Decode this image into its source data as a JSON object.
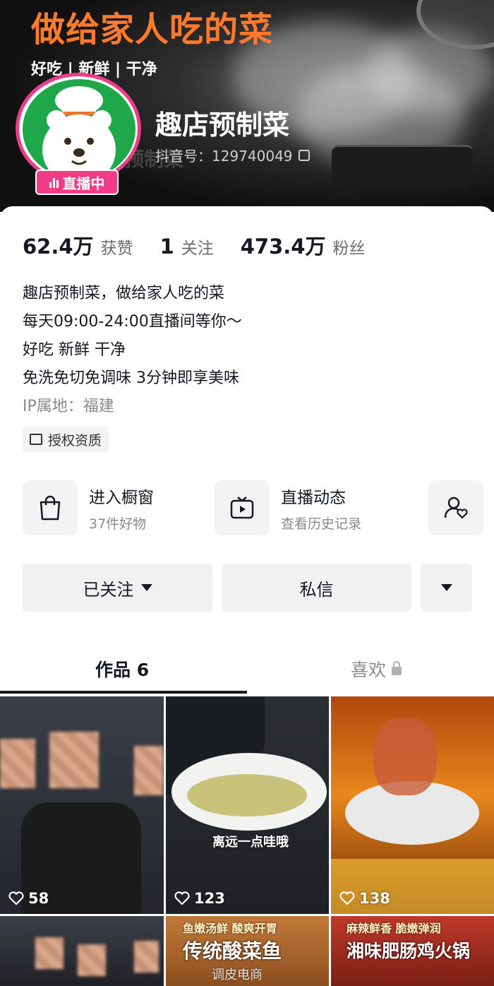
{
  "banner": {
    "title": "做给家人吃的菜",
    "subtitle": "好吃 | 新鲜 | 干净",
    "watermark": "预制菜"
  },
  "profile": {
    "name": "趣店预制菜",
    "douyin_id": "抖音号：129740049",
    "live_badge": "直播中"
  },
  "stats": [
    {
      "value": "62.4万",
      "label": "获赞"
    },
    {
      "value": "1",
      "label": "关注"
    },
    {
      "value": "473.4万",
      "label": "粉丝"
    }
  ],
  "bio": {
    "lines": [
      "趣店预制菜，做给家人吃的菜",
      "每天09:00-24:00直播间等你～",
      "好吃 新鲜 干净",
      "免洗免切免调味 3分钟即享美味"
    ],
    "ip": "IP属地：福建"
  },
  "auth_chip": "授权资质",
  "entries": {
    "shop": {
      "title": "进入橱窗",
      "sub": "37件好物"
    },
    "live": {
      "title": "直播动态",
      "sub": "查看历史记录"
    }
  },
  "buttons": {
    "followed": "已关注",
    "message": "私信"
  },
  "tabs": {
    "works": "作品 6",
    "likes": "喜欢"
  },
  "videos": [
    {
      "likes": "58"
    },
    {
      "likes": "123",
      "caption": "离远一点哇哦"
    },
    {
      "likes": "138"
    },
    {
      "caption": ""
    },
    {
      "caption": "传统酸菜鱼",
      "tag": "鱼嫩汤鲜 酸爽开胃"
    },
    {
      "caption": "湘味肥肠鸡火锅",
      "tag": "麻辣鲜香 脆嫩弹润"
    }
  ],
  "watermark": "调皮电商",
  "colors": {
    "live_pink": "#f03c86",
    "banner_orange": "#ff7a2c",
    "avatar_green": "#1fa84a"
  }
}
